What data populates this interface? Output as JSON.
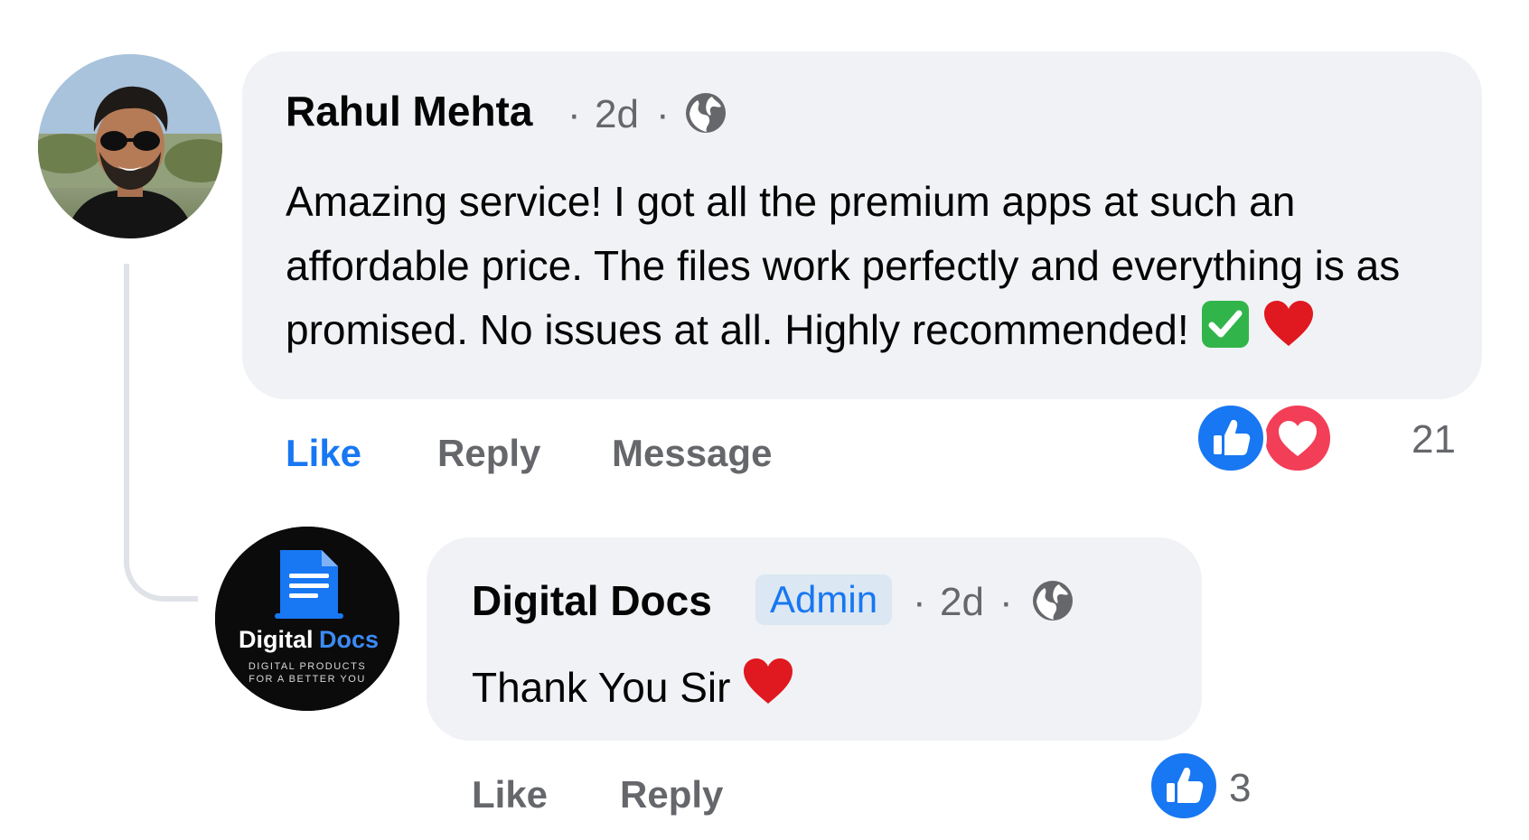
{
  "comment": {
    "author": "Rahul Mehta",
    "separator_1": "·",
    "time": "2d",
    "separator_2": "·",
    "privacy_icon": "globe-icon",
    "text": "Amazing service! I got all the premium apps at such an affordable price. The files work perfectly and everything is as promised. No issues at all. Highly recommended!",
    "emoji_icons": [
      "check-mark-icon",
      "red-heart-icon"
    ],
    "actions": {
      "like": "Like",
      "reply": "Reply",
      "message": "Message"
    },
    "like_active": true,
    "reactions": {
      "icons": [
        "like-reaction-icon",
        "love-reaction-icon"
      ],
      "count": "21"
    }
  },
  "reply": {
    "author": "Digital Docs",
    "badge": "Admin",
    "separator_1": "·",
    "time": "2d",
    "separator_2": "·",
    "privacy_icon": "globe-icon",
    "text": "Thank You Sir",
    "emoji_icons": [
      "red-heart-icon"
    ],
    "actions": {
      "like": "Like",
      "reply": "Reply"
    },
    "reactions": {
      "icons": [
        "like-reaction-icon"
      ],
      "count": "3"
    },
    "avatar": {
      "logo_name_part1": "Digital",
      "logo_name_part2": "Docs",
      "logo_tagline_line1": "DIGITAL PRODUCTS",
      "logo_tagline_line2": "FOR A BETTER YOU"
    }
  },
  "colors": {
    "brand_blue": "#1877f2",
    "bubble_bg": "#f0f2f5",
    "meta_gray": "#65676b",
    "love_red": "#f33e58",
    "admin_badge_bg": "#dbe7f2"
  }
}
